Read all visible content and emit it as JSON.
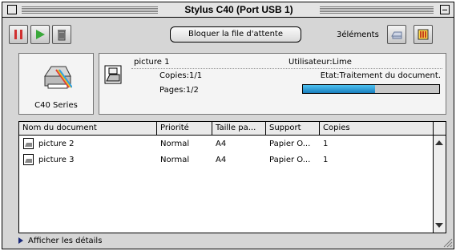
{
  "window": {
    "title": "Stylus C40 (Port USB 1)"
  },
  "toolbar": {
    "pause_icon": "pause-icon",
    "resume_icon": "play-icon",
    "delete_icon": "trash-icon",
    "hold_queue_label": "Bloquer la file d'attente",
    "elements_count_label": "3éléments",
    "print_icon": "printer-icon",
    "info_icon": "info-icon"
  },
  "printer": {
    "series_label": "C40 Series"
  },
  "current_job": {
    "name": "picture 1",
    "copies": "Copies:1/1",
    "pages": "Pages:1/2",
    "user": "Utilisateur:Lime",
    "state": "Etat:Traitement du document.",
    "progress": 0.53
  },
  "queue_table": {
    "headers": [
      "Nom du document",
      "Priorité",
      "Taille pa...",
      "Support",
      "Copies"
    ],
    "rows": [
      {
        "name": "picture 2",
        "priority": "Normal",
        "size": "A4",
        "media": "Papier O...",
        "copies": "1"
      },
      {
        "name": "picture 3",
        "priority": "Normal",
        "size": "A4",
        "media": "Papier O...",
        "copies": "1"
      }
    ]
  },
  "footer": {
    "details_label": "Afficher les détails"
  },
  "colors": {
    "progress": "#1a7fbf",
    "pause": "#d03030",
    "play": "#3aa83a"
  }
}
